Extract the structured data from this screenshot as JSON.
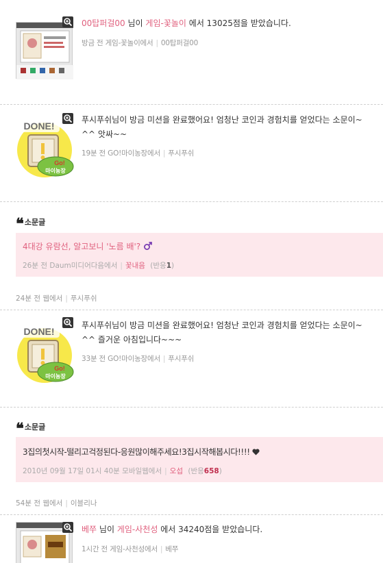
{
  "item1": {
    "user": "00탑퍼걸00",
    "mid1": "님이",
    "game": "게임-꽃놀이",
    "mid2": "에서 13025점을 받았습니다.",
    "meta_time": "방금 전 게임-꽃놀이에서",
    "meta_user": "00탑퍼걸00"
  },
  "item2": {
    "text": "푸시푸쉬님이 방금 미션을 완료했어요! 엄청난 코인과 경험치를 얻었다는 소문이~ ^^ 앗싸~~",
    "meta_time": "19분 전 GO!마이농장에서",
    "meta_user": "푸시푸쉬",
    "badge_done": "DONE!",
    "badge_go": "Go!",
    "badge_farm": "마이농장"
  },
  "quote1": {
    "header_label": "소문글",
    "text": "4대강 유람선, 알고보니 '노름 배'?",
    "meta_time": "26분 전 Daum미디어다음에서",
    "meta_user": "꽃내음",
    "meta_reply_label": "반응",
    "meta_reply_count": "1",
    "footer_time": "24분 전 웹에서",
    "footer_user": "푸시푸쉬"
  },
  "item3": {
    "text": "푸시푸쉬님이 방금 미션을 완료했어요! 엄청난 코인과 경험치를 얻었다는 소문이~ ^^ 즐거운 아침입니다~~~",
    "meta_time": "33분 전 GO!마이농장에서",
    "meta_user": "푸시푸쉬",
    "badge_done": "DONE!",
    "badge_go": "Go!",
    "badge_farm": "마이농장"
  },
  "quote2": {
    "header_label": "소문글",
    "text": "3집의첫시작-떨리고걱정된다-응원많이해주세요!3집시작해봅시다!!!!",
    "meta_time": "2010년 09월 17일 01시 40분 모바일웹에서",
    "meta_user": "오섭",
    "meta_reply_label": "반응",
    "meta_reply_count": "658",
    "footer_time": "54분 전 웹에서",
    "footer_user": "이블리나"
  },
  "item4": {
    "user": "베쭈",
    "mid1": "님이",
    "game": "게임-사천성",
    "mid2": "에서 34240점을 받았습니다.",
    "meta_time": "1시간 전 게임-사천성에서",
    "meta_user": "베쭈"
  },
  "colors": {
    "accent": "#e0607e",
    "quote_bg": "#fde8ec",
    "meta": "#999999"
  },
  "icons": [
    "zoom-icon",
    "quote-icon",
    "heart-icon",
    "male-icon",
    "done-badge-icon"
  ]
}
